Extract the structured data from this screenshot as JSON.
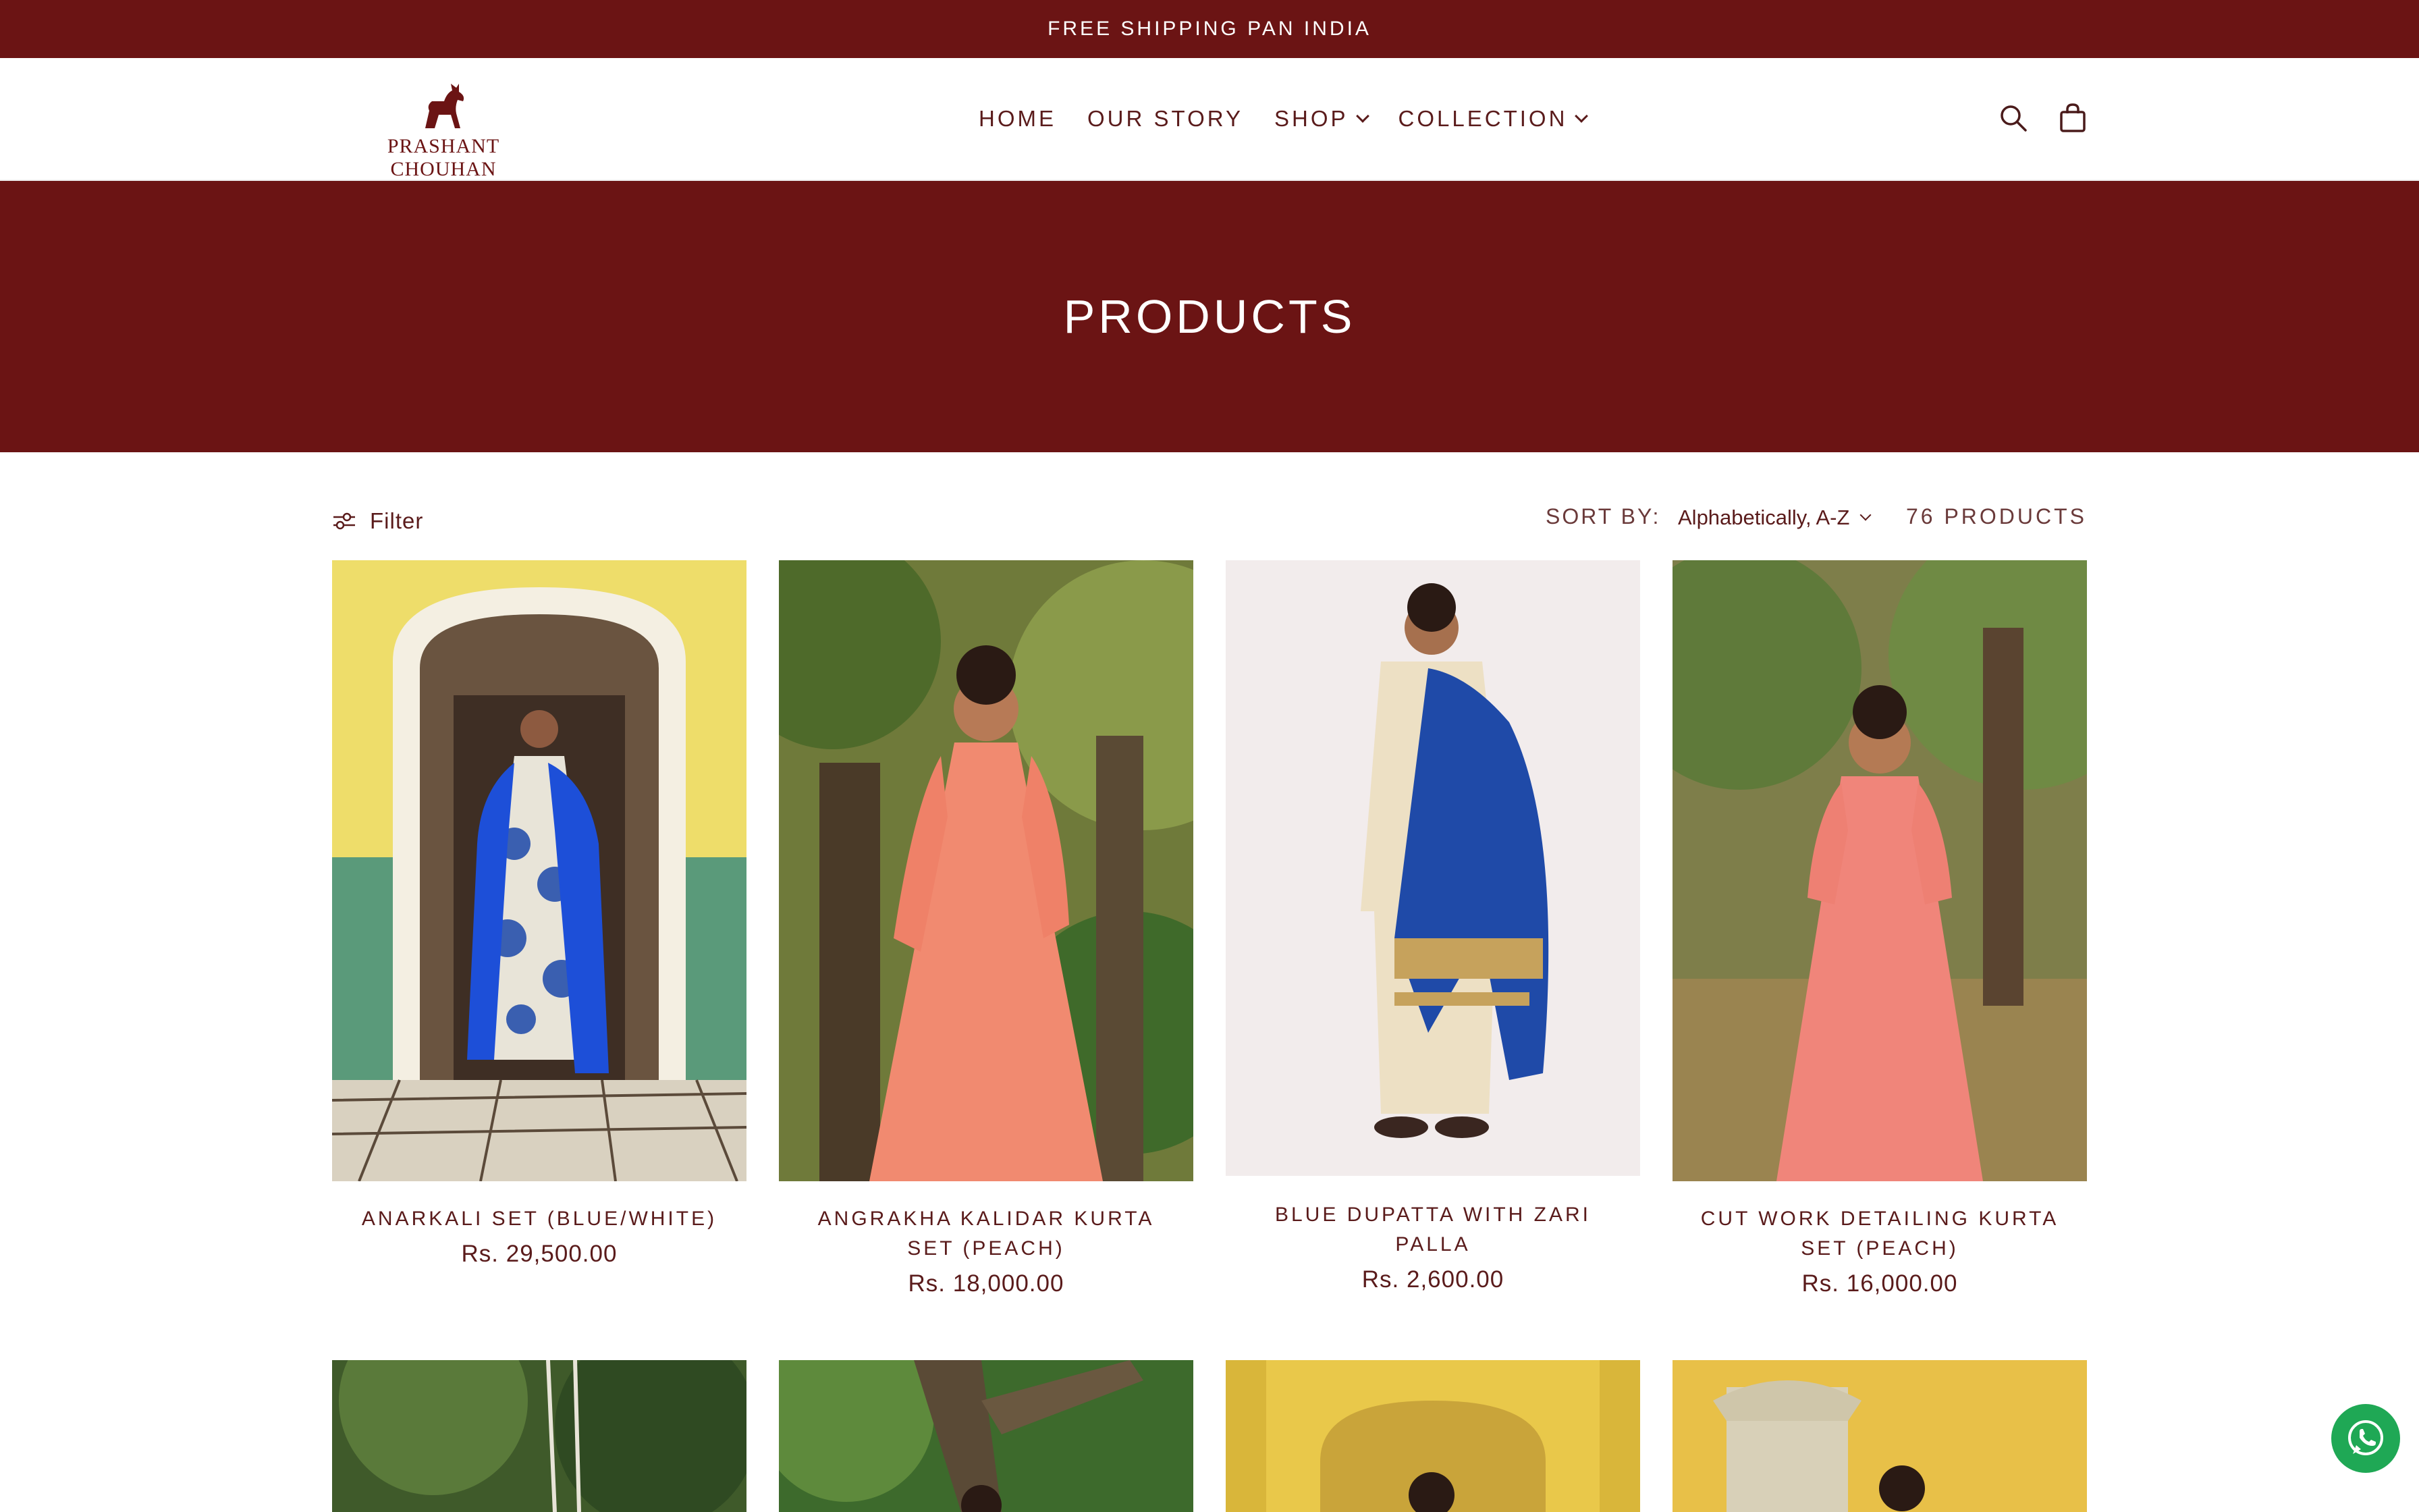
{
  "announcement": "FREE SHIPPING PAN INDIA",
  "brand": {
    "name": "PRASHANT CHOUHAN",
    "color": "#6b1414"
  },
  "nav": {
    "items": [
      {
        "label": "HOME",
        "dropdown": false
      },
      {
        "label": "OUR STORY",
        "dropdown": false
      },
      {
        "label": "SHOP",
        "dropdown": true
      },
      {
        "label": "COLLECTION",
        "dropdown": true
      }
    ],
    "icons": [
      "search-icon",
      "cart-icon"
    ]
  },
  "hero": {
    "title": "PRODUCTS"
  },
  "toolbar": {
    "filter_label": "Filter",
    "sort_label": "SORT BY:",
    "sort_value": "Alphabetically, A-Z",
    "product_count": "76 PRODUCTS"
  },
  "products": [
    {
      "title": "ANARKALI SET (BLUE/WHITE)",
      "price": "Rs. 29,500.00"
    },
    {
      "title": "ANGRAKHA KALIDAR KURTA SET (PEACH)",
      "price": "Rs. 18,000.00"
    },
    {
      "title": "BLUE DUPATTA WITH ZARI PALLA",
      "price": "Rs. 2,600.00"
    },
    {
      "title": "CUT WORK DETAILING KURTA SET (PEACH)",
      "price": "Rs. 16,000.00"
    }
  ],
  "colors": {
    "accent": "#6b1414",
    "whatsapp": "#1fa855"
  }
}
